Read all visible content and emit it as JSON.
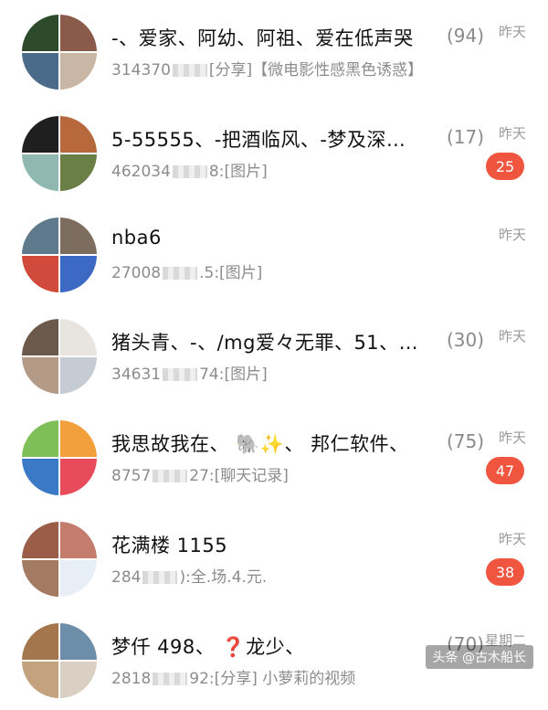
{
  "conversations": [
    {
      "title": "-、爱家、阿幼、阿祖、爱在低声哭",
      "count": "(94)",
      "time": "昨天",
      "sub_prefix": "314370",
      "sub_suffix": "[分享]【微电影性感黑色诱惑】",
      "badge": "",
      "avatar_colors": [
        "#2d4a2b",
        "#8a5a4a",
        "#4a6b8a",
        "#c9b6a5"
      ]
    },
    {
      "title": "5-55555、-把酒临风、-梦及深…",
      "count": "(17)",
      "time": "昨天",
      "sub_prefix": "462034",
      "sub_suffix": "8:[图片]",
      "badge": "25",
      "avatar_colors": [
        "#1f1f1f",
        "#b7683c",
        "#8fb8b0",
        "#6a7f46"
      ]
    },
    {
      "title": "nba6",
      "count": "",
      "time": "昨天",
      "sub_prefix": "27008",
      "sub_suffix": ".5:[图片]",
      "badge": "",
      "avatar_colors": [
        "#5f7a8c",
        "#7d6d5e",
        "#d14a3c",
        "#3b69c4"
      ]
    },
    {
      "title": "猪头青、-、/mg爱々无罪、51、…",
      "count": "(30)",
      "time": "昨天",
      "sub_prefix": "34631",
      "sub_suffix": "74:[图片]",
      "badge": "",
      "avatar_colors": [
        "#6b5a4c",
        "#e8e4df",
        "#b49b87",
        "#c6ccd4"
      ]
    },
    {
      "title": "我思故我在、 🐘✨、 邦仁软件、",
      "count": "(75)",
      "time": "昨天",
      "sub_prefix": "8757",
      "sub_suffix": "27:[聊天记录]",
      "badge": "47",
      "avatar_colors": [
        "#7fbf5a",
        "#f2a03b",
        "#3b78c6",
        "#e84b5a"
      ]
    },
    {
      "title": "花满楼 1155",
      "count": "",
      "time": "昨天",
      "sub_prefix": "284",
      "sub_suffix": "):全.场.4.元.",
      "badge": "38",
      "avatar_colors": [
        "#9b5d48",
        "#c47c6d",
        "#a37b63",
        "#e8eef5"
      ]
    },
    {
      "title": "梦仟 498、  ❓龙少、 ",
      "count": "(70)",
      "time": "星期二",
      "sub_prefix": "2818",
      "sub_suffix": "92:[分享] 小萝莉的视频",
      "badge": "",
      "avatar_colors": [
        "#a4764e",
        "#6d8ea8",
        "#c2a27f",
        "#d9cfc2"
      ]
    }
  ],
  "watermark": "头条 @古木船长"
}
